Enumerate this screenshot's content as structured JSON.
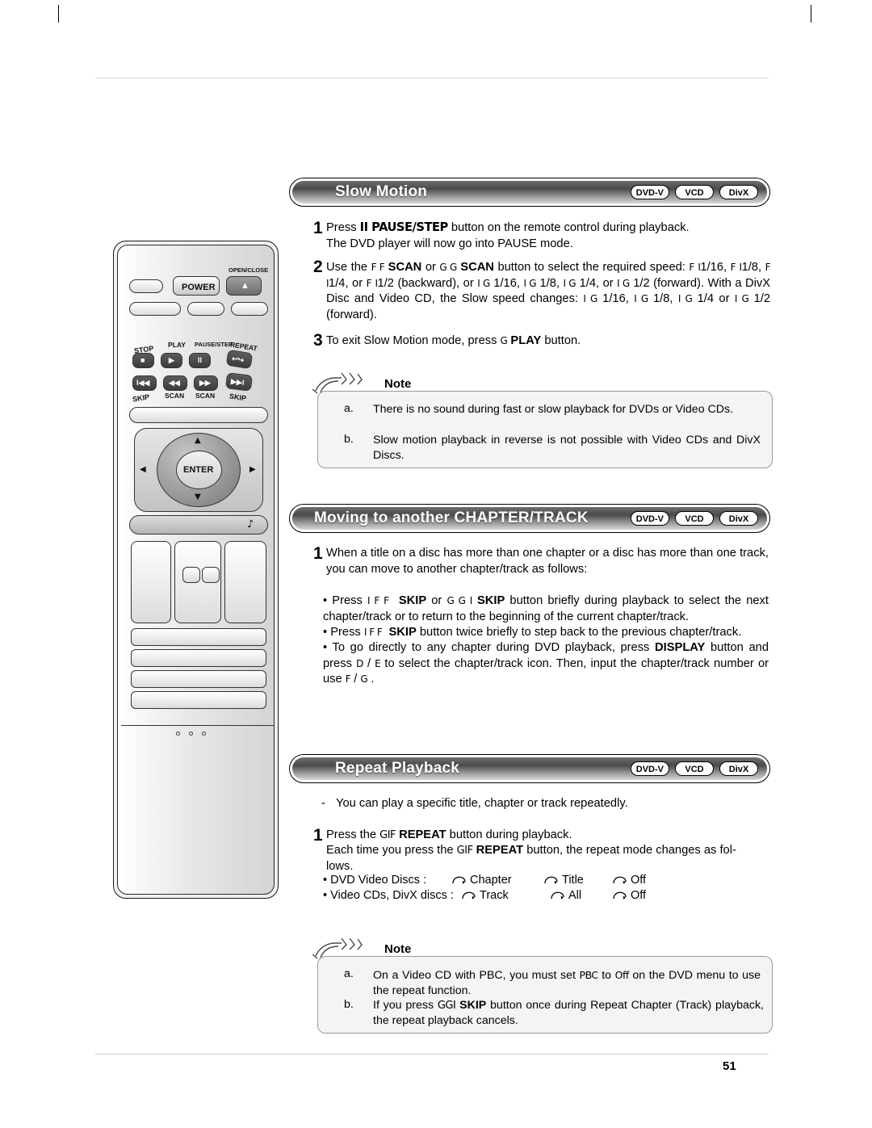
{
  "page": {
    "number": "51"
  },
  "sections": [
    {
      "id": "slow-motion",
      "title": "Slow Motion",
      "badges": [
        "DVD-V",
        "VCD",
        "DivX"
      ]
    },
    {
      "id": "moving-chapter-track",
      "title": "Moving to another CHAPTER/TRACK",
      "badges": [
        "DVD-V",
        "VCD",
        "DivX"
      ]
    },
    {
      "id": "repeat-playback",
      "title": "Repeat Playback",
      "badges": [
        "DVD-V",
        "VCD",
        "DivX"
      ]
    }
  ],
  "slow_motion": {
    "step1_num": "1",
    "step1_line1_pre": "Press ",
    "step1_line1_key": "II PAUSE/STEP",
    "step1_line1_post": " button on the remote control during playback.",
    "step1_line2": "The DVD player will now go into PAUSE mode.",
    "step2_num": "2",
    "step2_text": "Use the FF SCAN or GG SCAN button to select the required speed: F I1/16, F I1/8, F I1/4, or F I1/2 (backward), or IG 1/16, IG 1/8, IG 1/4, or IG 1/2 (forward). With a DivX Disc and Video CD, the Slow speed changes: IG 1/16, IG 1/8, IG 1/4 or IG 1/2 (forward).",
    "step3_num": "3",
    "step3_text": "To exit Slow Motion mode, press G PLAY button.",
    "note_label": "Note",
    "notes": [
      {
        "letter": "a.",
        "text": "There is no sound during fast or slow playback for DVDs or Video CDs."
      },
      {
        "letter": "b.",
        "text": "Slow motion playback in reverse is not possible with Video CDs and DivX Discs."
      }
    ]
  },
  "moving_chapter": {
    "step1_num": "1",
    "step1_text": "When a title on a disc has more than one chapter or a disc has more than one track, you can move to another chapter/track as follows:",
    "bullets": [
      "Press IFF SKIP or GGI SKIP button briefly during playback to select the next chapter/track or to return to the beginning of the current chapter/track.",
      "Press IFF SKIP button twice briefly to step back to the previous chapter/track.",
      "To go directly to any chapter during DVD playback, press DISPLAY button and press D / E to select the chapter/track icon. Then, input the chapter/track number or use F / G."
    ]
  },
  "repeat_playback": {
    "intro_dash": "-",
    "intro_text": "You can play a specific title, chapter or track repeatedly.",
    "step1_num": "1",
    "step1_text_a": "Press the ",
    "step1_key_a": "GIF REPEAT",
    "step1_text_b": " button during playback.",
    "step1_line2_a": "Each time you press the ",
    "step1_key_b": "GIF REPEAT",
    "step1_line2_b": " button, the repeat mode changes as fol-",
    "step1_line3": "lows.",
    "mode_rows": [
      {
        "label": "• DVD Video Discs :",
        "items": [
          "Chapter",
          "Title",
          "Off"
        ]
      },
      {
        "label": "• Video CDs, DivX discs :",
        "items": [
          "Track",
          "All",
          "Off"
        ]
      }
    ],
    "note_label": "Note",
    "notes": [
      {
        "letter": "a.",
        "text": "On a Video CD with PBC, you must set PBC  to Off  on the DVD menu to use the repeat function."
      },
      {
        "letter": "b.",
        "text": "If you press GGI SKIP button once during Repeat Chapter (Track) playback, the repeat playback cancels."
      }
    ]
  },
  "remote": {
    "name": "dvd-remote-control",
    "labels": {
      "power": "POWER",
      "open_close": "OPEN/CLOSE",
      "stop": "STOP",
      "play": "PLAY",
      "pause_step": "PAUSE/STEP",
      "repeat": "REPEAT",
      "skip_left": "SKIP",
      "scan_left": "SCAN",
      "scan_right": "SCAN",
      "skip_right": "SKIP",
      "enter": "ENTER"
    },
    "glyphs": {
      "eject": "▲",
      "stop": "■",
      "play": "▶",
      "pause": "II",
      "repeat": "↩↪",
      "skip_prev": "I◀◀",
      "scan_rev": "◀◀",
      "scan_fwd": "▶▶",
      "skip_next": "▶▶I",
      "up": "▲",
      "down": "▼",
      "left": "◀",
      "right": "▶"
    }
  }
}
